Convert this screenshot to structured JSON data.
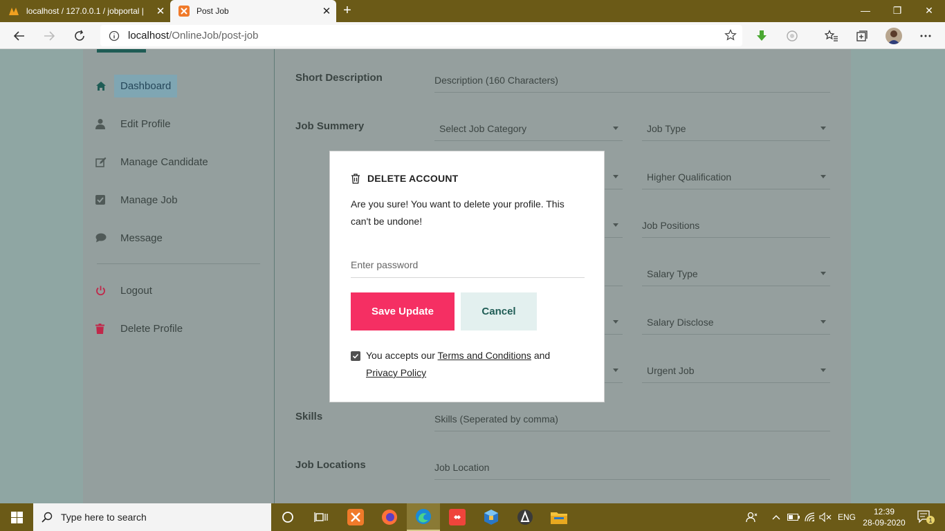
{
  "browser": {
    "tabs": [
      {
        "title": "localhost / 127.0.0.1 / jobportal |"
      },
      {
        "title": "Post Job"
      }
    ],
    "url_host": "localhost",
    "url_path": "/OnlineJob/post-job"
  },
  "sidebar": {
    "items": [
      {
        "label": "Dashboard",
        "icon": "home-icon"
      },
      {
        "label": "Edit Profile",
        "icon": "user-icon"
      },
      {
        "label": "Manage Candidate",
        "icon": "edit-icon"
      },
      {
        "label": "Manage Job",
        "icon": "checkbox-icon"
      },
      {
        "label": "Message",
        "icon": "chat-icon"
      },
      {
        "label": "Logout",
        "icon": "power-icon"
      },
      {
        "label": "Delete Profile",
        "icon": "trash-icon"
      }
    ]
  },
  "form": {
    "short_description_label": "Short Description",
    "short_description_placeholder": "Description (160 Characters)",
    "job_summary_label": "Job Summery",
    "job_category": "Select Job Category",
    "job_type": "Job Type",
    "higher_qualification": "Higher Qualification",
    "job_positions": "Job Positions",
    "salary_type": "Salary Type",
    "salary_disclose": "Salary Disclose",
    "urgent_job": "Urgent Job",
    "skills_label": "Skills",
    "skills_placeholder": "Skills (Seperated by comma)",
    "job_locations_label": "Job Locations",
    "job_location_placeholder": "Job Location"
  },
  "modal": {
    "title": "DELETE ACCOUNT",
    "message": "Are you sure! You want to delete your profile. This can't be undone!",
    "password_placeholder": "Enter password",
    "save_label": "Save Update",
    "cancel_label": "Cancel",
    "terms_prefix": "You accepts our",
    "terms_link": "Terms and Conditions",
    "terms_and": "and",
    "privacy_link": "Privacy Policy",
    "terms_checked": true
  },
  "taskbar": {
    "search_placeholder": "Type here to search",
    "language": "ENG",
    "time": "12:39",
    "date": "28-09-2020",
    "notification_count": "1"
  },
  "colors": {
    "accent_pink": "#f52f63",
    "accent_teal": "#1f5c55",
    "taskbar": "#6b5a17"
  }
}
